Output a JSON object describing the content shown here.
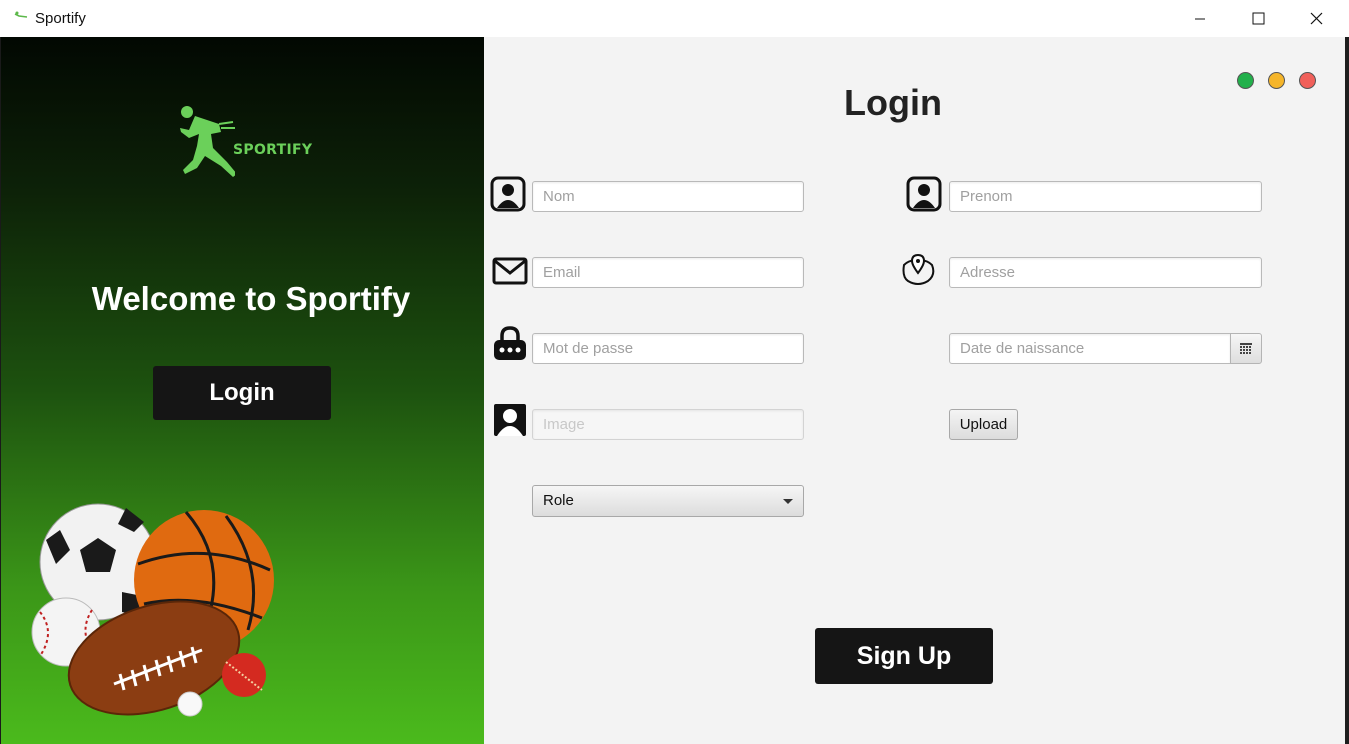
{
  "window": {
    "title": "Sportify"
  },
  "left_panel": {
    "logo_text": "SPORTIFY",
    "welcome": "Welcome to Sportify",
    "login_button": "Login",
    "gradient_top": "#020802",
    "gradient_bottom": "#4bba1c"
  },
  "form": {
    "title": "Login",
    "nom_placeholder": "Nom",
    "prenom_placeholder": "Prenom",
    "email_placeholder": "Email",
    "adresse_placeholder": "Adresse",
    "password_placeholder": "Mot de passe",
    "birthdate_placeholder": "Date de naissance",
    "image_placeholder": "Image",
    "upload_button": "Upload",
    "role_selected": "Role",
    "signup_button": "Sign Up"
  },
  "window_dots": {
    "green": "#22b04b",
    "yellow": "#f5b52a",
    "red": "#f0605a"
  },
  "icons": {
    "nom": "user-icon",
    "prenom": "user-icon",
    "email": "envelope-icon",
    "adresse": "map-location-icon",
    "password": "lock-icon",
    "image": "person-silhouette-icon",
    "date": "calendar-icon"
  }
}
